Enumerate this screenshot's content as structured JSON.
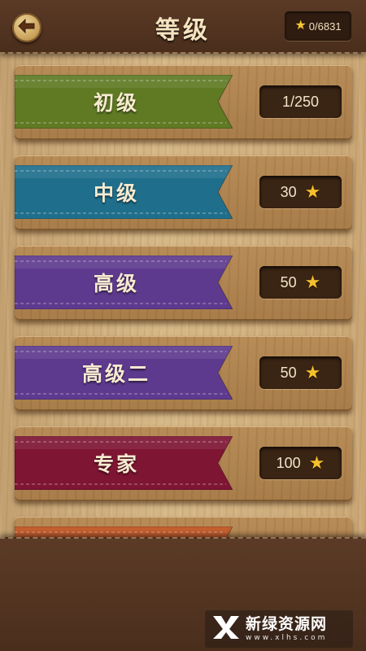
{
  "header": {
    "title": "等级",
    "total_stars": "0/6831"
  },
  "levels": [
    {
      "name": "初级",
      "requirement": "1/250",
      "has_star": false,
      "color": "#5f7a23"
    },
    {
      "name": "中级",
      "requirement": "30",
      "has_star": true,
      "color": "#1f6f8c"
    },
    {
      "name": "高级",
      "requirement": "50",
      "has_star": true,
      "color": "#5e3a8f"
    },
    {
      "name": "高级二",
      "requirement": "50",
      "has_star": true,
      "color": "#5e3a8f"
    },
    {
      "name": "专家",
      "requirement": "100",
      "has_star": true,
      "color": "#7e1533"
    },
    {
      "name": "",
      "requirement": "",
      "has_star": false,
      "color": "#c0521e"
    }
  ],
  "watermark": {
    "title": "新绿资源网",
    "url": "www.xlhs.com"
  }
}
